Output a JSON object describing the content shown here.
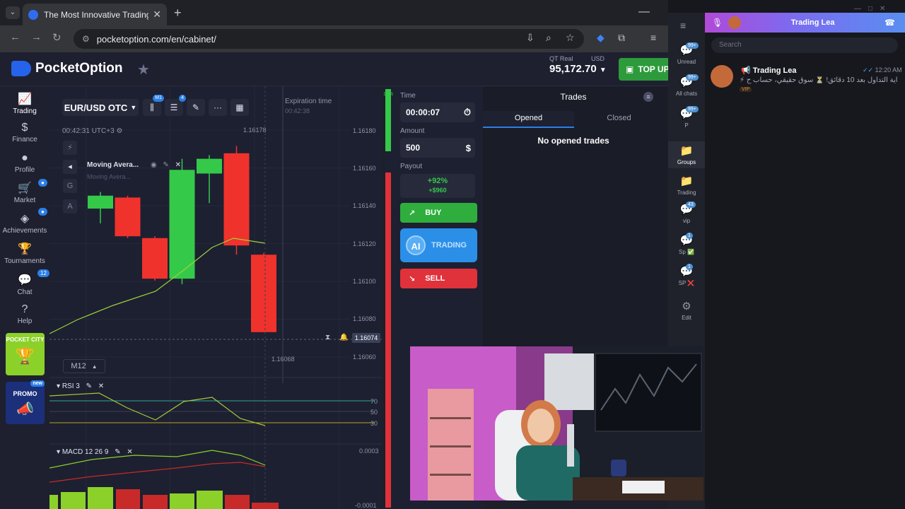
{
  "browser": {
    "tab_title": "The Most Innovative Trading Pl",
    "url": "pocketoption.com/en/cabinet/"
  },
  "site": {
    "logo_text": "PocketOption",
    "account_type": "QT Real",
    "currency": "USD",
    "balance": "95,172.70",
    "top_up": "TOP UP"
  },
  "sidebar": {
    "items": [
      {
        "label": "Trading",
        "icon": "chart-icon"
      },
      {
        "label": "Finance",
        "icon": "dollar-icon"
      },
      {
        "label": "Profile",
        "icon": "user-icon"
      },
      {
        "label": "Market",
        "icon": "cart-icon"
      },
      {
        "label": "Achievements",
        "icon": "diamond-icon"
      },
      {
        "label": "Tournaments",
        "icon": "trophy-icon"
      },
      {
        "label": "Chat",
        "icon": "chat-icon"
      },
      {
        "label": "Help",
        "icon": "help-icon"
      }
    ],
    "chat_badge": "12",
    "pocket_city": "POCKET CITY",
    "promo": "PROMO",
    "promo_new": "new"
  },
  "chart": {
    "pair": "EUR/USD OTC",
    "toolbar_badges": [
      "M1",
      "4"
    ],
    "clock": "00:42:31 UTC+3",
    "indicator_name": "Moving Avera...",
    "indicator_ghost": "Moving Avera...",
    "side_tools": [
      "G",
      "A"
    ],
    "timeframe": "M12",
    "rsi_label": "RSI 3",
    "macd_label": "MACD 12 26 9",
    "expiration_label": "Expiration time",
    "expiration_value": "00:42:38",
    "top_price": "1.16178",
    "current_price": "1.16074",
    "below_price": "1.16068",
    "y_ticks": [
      "1.16180",
      "1.16160",
      "1.16140",
      "1.16120",
      "1.16100",
      "1.16080",
      "1.16060"
    ],
    "rsi_ticks": [
      "70",
      "50",
      "30"
    ],
    "macd_ticks": [
      "0.0003",
      "-0.0001"
    ],
    "sentiment_pct": "15%"
  },
  "chart_data": {
    "type": "candlestick",
    "candles": [
      {
        "o": 1.16141,
        "c": 1.16148,
        "h": 1.1615,
        "l": 1.16133
      },
      {
        "o": 1.16147,
        "c": 1.16126,
        "h": 1.16148,
        "l": 1.16125
      },
      {
        "o": 1.16125,
        "c": 1.16103,
        "h": 1.16126,
        "l": 1.16102
      },
      {
        "o": 1.16103,
        "c": 1.16162,
        "h": 1.16168,
        "l": 1.161
      },
      {
        "o": 1.1616,
        "c": 1.16168,
        "h": 1.1617,
        "l": 1.16144
      },
      {
        "o": 1.16171,
        "c": 1.16121,
        "h": 1.16175,
        "l": 1.16116
      },
      {
        "o": 1.16116,
        "c": 1.16074,
        "h": 1.16117,
        "l": 1.16074
      }
    ],
    "ylim": [
      1.16054,
      1.16192
    ]
  },
  "trade": {
    "time_label": "Time",
    "time_value": "00:00:07",
    "amount_label": "Amount",
    "amount_value": "500",
    "payout_label": "Payout",
    "payout_pct": "+92%",
    "payout_amount": "+$960",
    "buy": "BUY",
    "ai_badge": "AI",
    "ai_trading": "TRADING",
    "sell": "SELL"
  },
  "trades": {
    "title": "Trades",
    "tab_opened": "Opened",
    "tab_closed": "Closed",
    "empty": "No opened trades"
  },
  "telegram": {
    "call_title": "Trading Lea",
    "search": "Search",
    "folders": [
      {
        "label": "Unread",
        "badge": "99+"
      },
      {
        "label": "All chats",
        "badge": "99+"
      },
      {
        "label": "P",
        "badge": "99+"
      },
      {
        "label": "Groups",
        "badge": ""
      },
      {
        "label": "Trading",
        "badge": ""
      },
      {
        "label": "vip",
        "badge": "43"
      },
      {
        "label": "Sp ✅",
        "badge": "1"
      },
      {
        "label": "SP ❌",
        "badge": "1"
      },
      {
        "label": "Edit",
        "badge": ""
      }
    ],
    "chat": {
      "name": "Trading Lea",
      "time": "12:20 AM",
      "message": "⚡ بداية التداول بعد 10 دقائق! ⏳ سوق حقيقي، حساب ح...",
      "tag": "VIP"
    }
  },
  "colors": {
    "green": "#35c94a",
    "red": "#f0322d",
    "accent": "#2b7fe8"
  }
}
